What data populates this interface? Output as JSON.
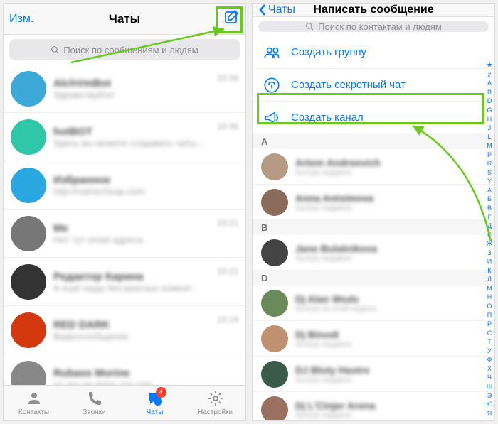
{
  "left": {
    "edit": "Изм.",
    "title": "Чаты",
    "search_placeholder": "Поиск по сообщениям и людям",
    "chats": [
      {
        "name": "AlchVmBot",
        "sub": "Здравствуйте!",
        "time": "10:39",
        "avatar": "#3ba8d8"
      },
      {
        "name": "hotBOT",
        "sub": "Здесь вы можете создавать чаты...",
        "time": "10:36",
        "avatar": "#2fc7a8"
      },
      {
        "name": "Избранное",
        "sub": "http://namecheap.com",
        "time": "",
        "avatar": "#2aa7e0"
      },
      {
        "name": "Me",
        "sub": "Нет тут email адреса",
        "time": "10:21",
        "avatar": "#777777"
      },
      {
        "name": "Редактор Карина",
        "sub": "А ещё сюда без красных комнат...",
        "time": "10:21",
        "avatar": "#333333"
      },
      {
        "name": "RED DARK",
        "sub": "Видеосообщение",
        "time": "10:19",
        "avatar": "#d3380f"
      },
      {
        "name": "Rubass Morine",
        "sub": "но это не факт что там...",
        "time": "",
        "avatar": "#888888"
      }
    ],
    "tabs": {
      "contacts": "Контакты",
      "calls": "Звонки",
      "chats": "Чаты",
      "settings": "Настройки",
      "badge": "4"
    }
  },
  "right": {
    "back": "Чаты",
    "title": "Написать сообщение",
    "search_placeholder": "Поиск по контактам и людям",
    "actions": {
      "group": "Создать группу",
      "secret": "Создать секретный чат",
      "channel": "Создать канал"
    },
    "sections": [
      {
        "letter": "A",
        "contacts": [
          {
            "name": "Artem Andreevich",
            "sub": "был(а) недавно",
            "avatar": "#b59a84"
          },
          {
            "name": "Anna Antsimova",
            "sub": "был(а) недавно",
            "avatar": "#8a6a5a"
          }
        ]
      },
      {
        "letter": "B",
        "contacts": [
          {
            "name": "Jane Bulatnikova",
            "sub": "был(а) недавно",
            "avatar": "#444444"
          }
        ]
      },
      {
        "letter": "D",
        "contacts": [
          {
            "name": "Dj Alan Wods",
            "sub": "был(а) на этой неделе",
            "avatar": "#6a8a5a"
          },
          {
            "name": "Dj Binodi",
            "sub": "был(а) недавно",
            "avatar": "#c09070"
          },
          {
            "name": "DJ Bluty Hastre",
            "sub": "был(а) недавно",
            "avatar": "#3a5a4a"
          },
          {
            "name": "Dj L'Cinjer Arena",
            "sub": "был(а) недавно",
            "avatar": "#9a7060"
          }
        ]
      }
    ],
    "index": [
      "★",
      "#",
      "A",
      "B",
      "D",
      "G",
      "H",
      "J",
      "L",
      "M",
      "P",
      "R",
      "S",
      "Y",
      "А",
      "Б",
      "В",
      "Г",
      "Д",
      "Е",
      "Ж",
      "З",
      "И",
      "К",
      "Л",
      "М",
      "Н",
      "О",
      "П",
      "Р",
      "С",
      "Т",
      "У",
      "Ф",
      "Х",
      "Ч",
      "Ш",
      "Э",
      "Ю",
      "Я"
    ]
  }
}
